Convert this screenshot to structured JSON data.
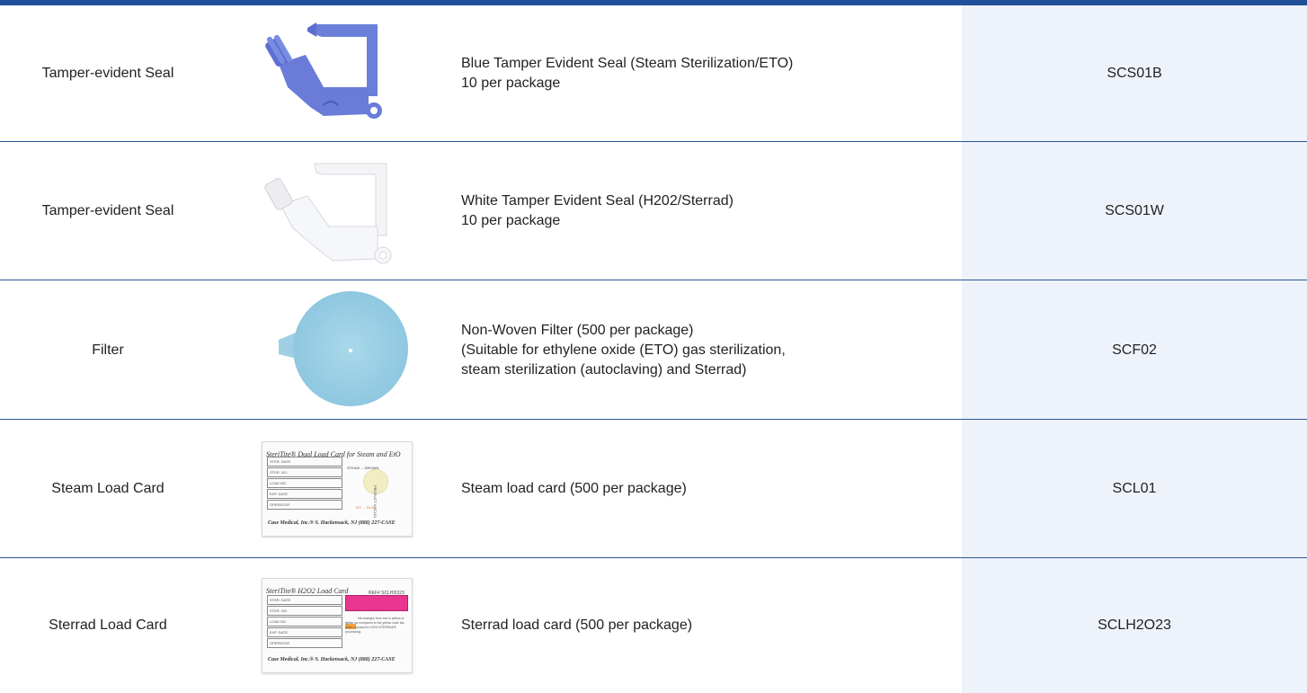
{
  "colors": {
    "accent_bar": "#1f4f9a",
    "divider": "#2a5598",
    "code_column_bg": "#eef3fb"
  },
  "rows": [
    {
      "type": "Tamper-evident Seal",
      "image": "blue-tamper-seal-image",
      "description": [
        "Blue Tamper Evident Seal (Steam Sterilization/ETO)",
        "10 per package"
      ],
      "code": "SCS01B"
    },
    {
      "type": "Tamper-evident Seal",
      "image": "white-tamper-seal-image",
      "description": [
        "White Tamper Evident Seal (H202/Sterrad)",
        "10 per package"
      ],
      "code": "SCS01W"
    },
    {
      "type": "Filter",
      "image": "non-woven-filter-image",
      "description": [
        "Non-Woven Filter (500 per package)",
        "(Suitable for ethylene oxide (ETO) gas sterilization,",
        "steam sterilization (autoclaving) and Sterrad)"
      ],
      "code": "SCF02"
    },
    {
      "type": "Steam Load Card",
      "image": "steam-load-card-image",
      "description": [
        "Steam load card (500 per package)"
      ],
      "code": "SCL01",
      "card": {
        "title": "SteriTite® Dual Load Card for Steam and EtO",
        "fields": [
          "STER. DATE",
          "STER. NO.",
          "LOAD NO.",
          "EXP. DATE",
          "OPERATOR"
        ],
        "indicator_top": "STEAM → BROWN",
        "indicator_bottom": "EO → RUST",
        "product": "PRODUCT # SCL01",
        "footer": "Case Medical, Inc.® S. Hackensack, NJ (888) 227-CASE"
      }
    },
    {
      "type": "Sterrad Load Card",
      "image": "sterrad-load-card-image",
      "description": [
        "Sterrad load card (500 per package)"
      ],
      "code": "SCLH2O23",
      "card": {
        "title": "SteriTite® H2O2 Load Card",
        "ref": "REF# SCLH2O23",
        "fields": [
          "STER. DATE",
          "STER. NO.",
          "LOAD NO.",
          "EXP. DATE",
          "OPERATOR"
        ],
        "note": "Ink changes from red to yellow or lighter as compared to the yellow color bar when exposed to H2O2 STERRAD® processing.",
        "footer": "Case Medical, Inc.® S. Hackensack, NJ (888) 227-CASE"
      }
    }
  ]
}
